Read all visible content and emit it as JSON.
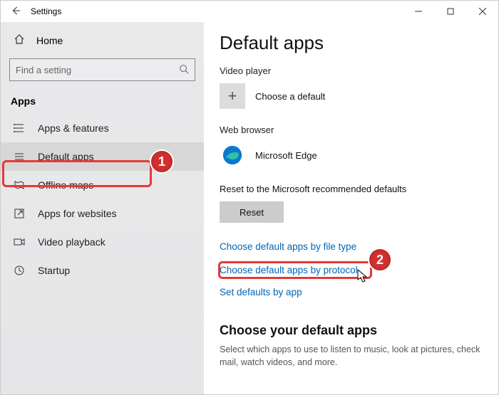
{
  "titlebar": {
    "title": "Settings"
  },
  "sidebar": {
    "home_label": "Home",
    "search_placeholder": "Find a setting",
    "group_header": "Apps",
    "items": [
      {
        "label": "Apps & features"
      },
      {
        "label": "Default apps"
      },
      {
        "label": "Offline maps"
      },
      {
        "label": "Apps for websites"
      },
      {
        "label": "Video playback"
      },
      {
        "label": "Startup"
      }
    ]
  },
  "content": {
    "heading": "Default apps",
    "video_player_label": "Video player",
    "choose_default_label": "Choose a default",
    "web_browser_label": "Web browser",
    "edge_label": "Microsoft Edge",
    "reset_label": "Reset to the Microsoft recommended defaults",
    "reset_button": "Reset",
    "link_file_type": "Choose default apps by file type",
    "link_protocol": "Choose default apps by protocol",
    "link_set_by_app": "Set defaults by app",
    "choose_heading": "Choose your default apps",
    "choose_paragraph": "Select which apps to use to listen to music, look at pictures, check mail, watch videos, and more."
  },
  "annotations": {
    "badge1": "1",
    "badge2": "2"
  }
}
